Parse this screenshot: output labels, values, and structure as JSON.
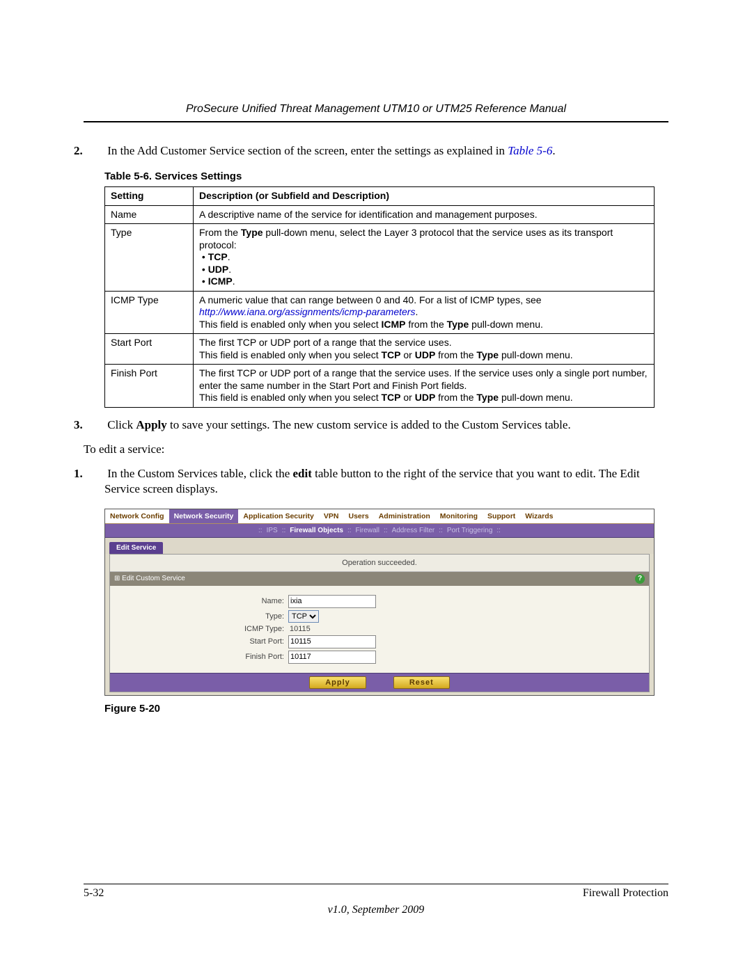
{
  "header": {
    "title": "ProSecure Unified Threat Management UTM10 or UTM25 Reference Manual"
  },
  "step2": {
    "num": "2.",
    "text_a": "In the Add Customer Service section of the screen, enter the settings as explained in ",
    "table_ref": "Table 5-6",
    "text_b": "."
  },
  "table_caption": "Table 5-6. Services Settings",
  "table": {
    "head_setting": "Setting",
    "head_desc": "Description (or Subfield and Description)",
    "rows": {
      "name": {
        "setting": "Name",
        "desc": "A descriptive name of the service for identification and management purposes."
      },
      "type": {
        "setting": "Type",
        "prefix": "From the ",
        "b1": "Type",
        "mid1": " pull-down menu, select the Layer 3 protocol that the service uses as its transport protocol:",
        "li1": "TCP",
        "li2": "UDP",
        "li3": "ICMP"
      },
      "icmp": {
        "setting": "ICMP Type",
        "l1": "A numeric value that can range between 0 and 40. For a list of ICMP types, see",
        "link": "http://www.iana.org/assignments/icmp-parameters",
        "link_suffix": ".",
        "l2a": "This field is enabled only when you select ",
        "l2b": "ICMP",
        "l2c": " from the ",
        "l2d": "Type",
        "l2e": " pull-down menu."
      },
      "start": {
        "setting": "Start Port",
        "l1": "The first TCP or UDP port of a range that the service uses.",
        "l2a": "This field is enabled only when you select ",
        "l2b": "TCP",
        "l2c": " or ",
        "l2d": "UDP",
        "l2e": " from the ",
        "l2f": "Type",
        "l2g": " pull-down menu."
      },
      "finish": {
        "setting": "Finish Port",
        "l1": "The first TCP or UDP port of a range that the service uses. If the service uses only a single port number, enter the same number in the Start Port and Finish Port fields.",
        "l2a": "This field is enabled only when you select ",
        "l2b": "TCP",
        "l2c": " or ",
        "l2d": "UDP",
        "l2e": " from the ",
        "l2f": "Type",
        "l2g": " pull-down menu."
      }
    }
  },
  "step3": {
    "num": "3.",
    "a": "Click ",
    "b": "Apply",
    "c": " to save your settings. The new custom service is added to the Custom Services table."
  },
  "editline": "To edit a service:",
  "step1b": {
    "num": "1.",
    "a": "In the Custom Services table, click the ",
    "b": "edit",
    "c": " table button to the right of the service that you want to edit. The Edit Service screen displays."
  },
  "ui": {
    "tabs": [
      "Network Config",
      "Network Security",
      "Application Security",
      "VPN",
      "Users",
      "Administration",
      "Monitoring",
      "Support",
      "Wizards"
    ],
    "subtabs": [
      "IPS",
      "Firewall Objects",
      "Firewall",
      "Address Filter",
      "Port Triggering"
    ],
    "edit_service_tab": "Edit Service",
    "op_success": "Operation succeeded.",
    "section_title": "Edit Custom Service",
    "help": "?",
    "labels": {
      "name": "Name:",
      "type": "Type:",
      "icmp": "ICMP Type:",
      "start": "Start Port:",
      "finish": "Finish Port:"
    },
    "values": {
      "name": "ixia",
      "type": "TCP",
      "icmp": "10115",
      "start": "10115",
      "finish": "10117"
    },
    "buttons": {
      "apply": "Apply",
      "reset": "Reset"
    }
  },
  "figure_caption": "Figure 5-20",
  "footer": {
    "page_num": "5-32",
    "section": "Firewall Protection",
    "version": "v1.0, September 2009"
  }
}
